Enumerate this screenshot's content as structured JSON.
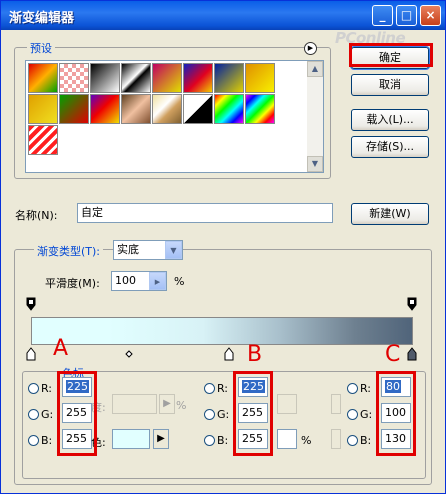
{
  "window": {
    "title": "渐变编辑器",
    "controls": [
      "_",
      "□",
      "×"
    ]
  },
  "watermark": "PConline",
  "presets": {
    "label": "预设",
    "swatches": [
      "linear-gradient(135deg,#e00000,#ffb000 50%,#00a000)",
      "repeating-conic-gradient(#f0a0a0 0 25%,#ffffff 0 50%) 0 0/8px 8px",
      "linear-gradient(135deg,#000,#fff)",
      "linear-gradient(135deg,#000,#fff 45%,#000 55%,#fff)",
      "linear-gradient(135deg,#c00060,#e0e000)",
      "linear-gradient(135deg,#1020c0,#e00020 55%,#f0d000)",
      "linear-gradient(135deg,#0020a0,#e0d000)",
      "linear-gradient(135deg,#e09000,#f8f000)",
      "linear-gradient(135deg,#e0a000,#f0e020)",
      "linear-gradient(135deg,#00a000,#e00000)",
      "linear-gradient(135deg,#6000c0,#f00000 45%,#f0e000)",
      "linear-gradient(135deg,#604020,#f0c0a0 50%,#805030)",
      "linear-gradient(135deg,#f0e0a0,#ffffff 40%,#d0a060 60%,#806030)",
      "linear-gradient(135deg,#ffffff,#ffffff 50%,#000 50%,#000)",
      "linear-gradient(135deg,#ff0000,#ffff00,#00ff00,#00ffff,#0000ff,#ff00ff)",
      "linear-gradient(135deg,#ff00ff,#0000ff,#00ffff,#00ff00,#ffff00,#ff0000,#ff00ff)",
      "repeating-linear-gradient(135deg,#ff2020 0 4px,#ffffff 4px 7px)"
    ]
  },
  "buttons": {
    "ok": "确定",
    "cancel": "取消",
    "load": "载入(L)...",
    "save": "存储(S)...",
    "new": "新建(W)"
  },
  "name": {
    "label": "名称(N):",
    "value": "自定"
  },
  "gradient": {
    "type_label": "渐变类型(T):",
    "type_value": "实底",
    "smooth_label": "平滑度(M):",
    "smooth_value": "100",
    "percent": "%"
  },
  "stops_group": {
    "label": "色标"
  },
  "color_channels": {
    "A": {
      "r": "225",
      "g": "255",
      "b": "255"
    },
    "B": {
      "r": "225",
      "g": "255",
      "b": "255"
    },
    "C": {
      "r": "80",
      "g": "100",
      "b": "130"
    }
  },
  "channel_labels": {
    "r": "R:",
    "g": "G:",
    "b": "B:"
  },
  "misc_labels": {
    "opacity_tail": "度:",
    "color_tail": "色:",
    "percent": "%"
  },
  "annotations": {
    "A": "A",
    "B": "B",
    "C": "C"
  },
  "colors": {
    "stop_color": "#e1ffff",
    "annotation_red": "#e00000"
  }
}
